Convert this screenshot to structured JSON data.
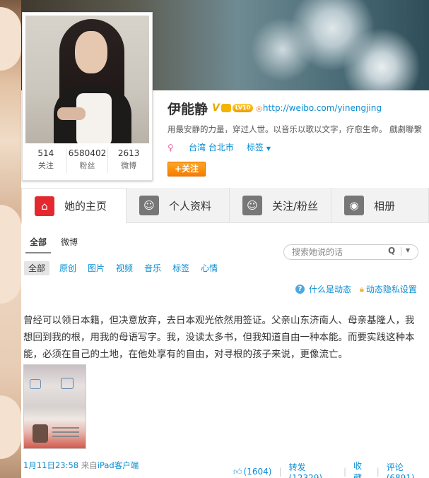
{
  "profile": {
    "name": "伊能静",
    "verified": "V",
    "level_badge": "LV10",
    "homepage_url": "http://weibo.com/yinengjing",
    "bio": "用最安静的力量，穿过人世。以音乐以歌以文字，疗愈生命。 戲劇聯繫",
    "location": "台湾 台北市",
    "tags_label": "标签",
    "follow_button": "+关注",
    "stats": [
      {
        "num": "514",
        "label": "关注"
      },
      {
        "num": "6580402",
        "label": "粉丝"
      },
      {
        "num": "2613",
        "label": "微博"
      }
    ]
  },
  "tabs": [
    {
      "label": "她的主页",
      "icon": "home-icon"
    },
    {
      "label": "个人资料",
      "icon": "user-icon"
    },
    {
      "label": "关注/粉丝",
      "icon": "users-icon"
    },
    {
      "label": "相册",
      "icon": "camera-icon"
    }
  ],
  "subnav": {
    "all": "全部",
    "weibo": "微博"
  },
  "search": {
    "placeholder": "搜索她说的话"
  },
  "filters": [
    "全部",
    "原创",
    "图片",
    "视频",
    "音乐",
    "标签",
    "心情"
  ],
  "help": {
    "what_is": "什么是动态",
    "privacy": "动态隐私设置"
  },
  "post": {
    "text": "曾经可以领日本籍，但决意放弃，去日本观光依然用签证。父亲山东济南人、母亲基隆人，我想回到我的根，用我的母语写字。我，没读太多书，但我知道自由一种本能。而要实践这种本能，必须在自己的土地，在他处享有的自由，对寻根的孩子来说，更像流亡。",
    "time": "1月11日23:58",
    "source_prefix": "来自",
    "source": "iPad客户端",
    "likes": "(1604)",
    "repost": "转发(12329)",
    "favorite": "收藏",
    "comment": "评论(6891)"
  }
}
